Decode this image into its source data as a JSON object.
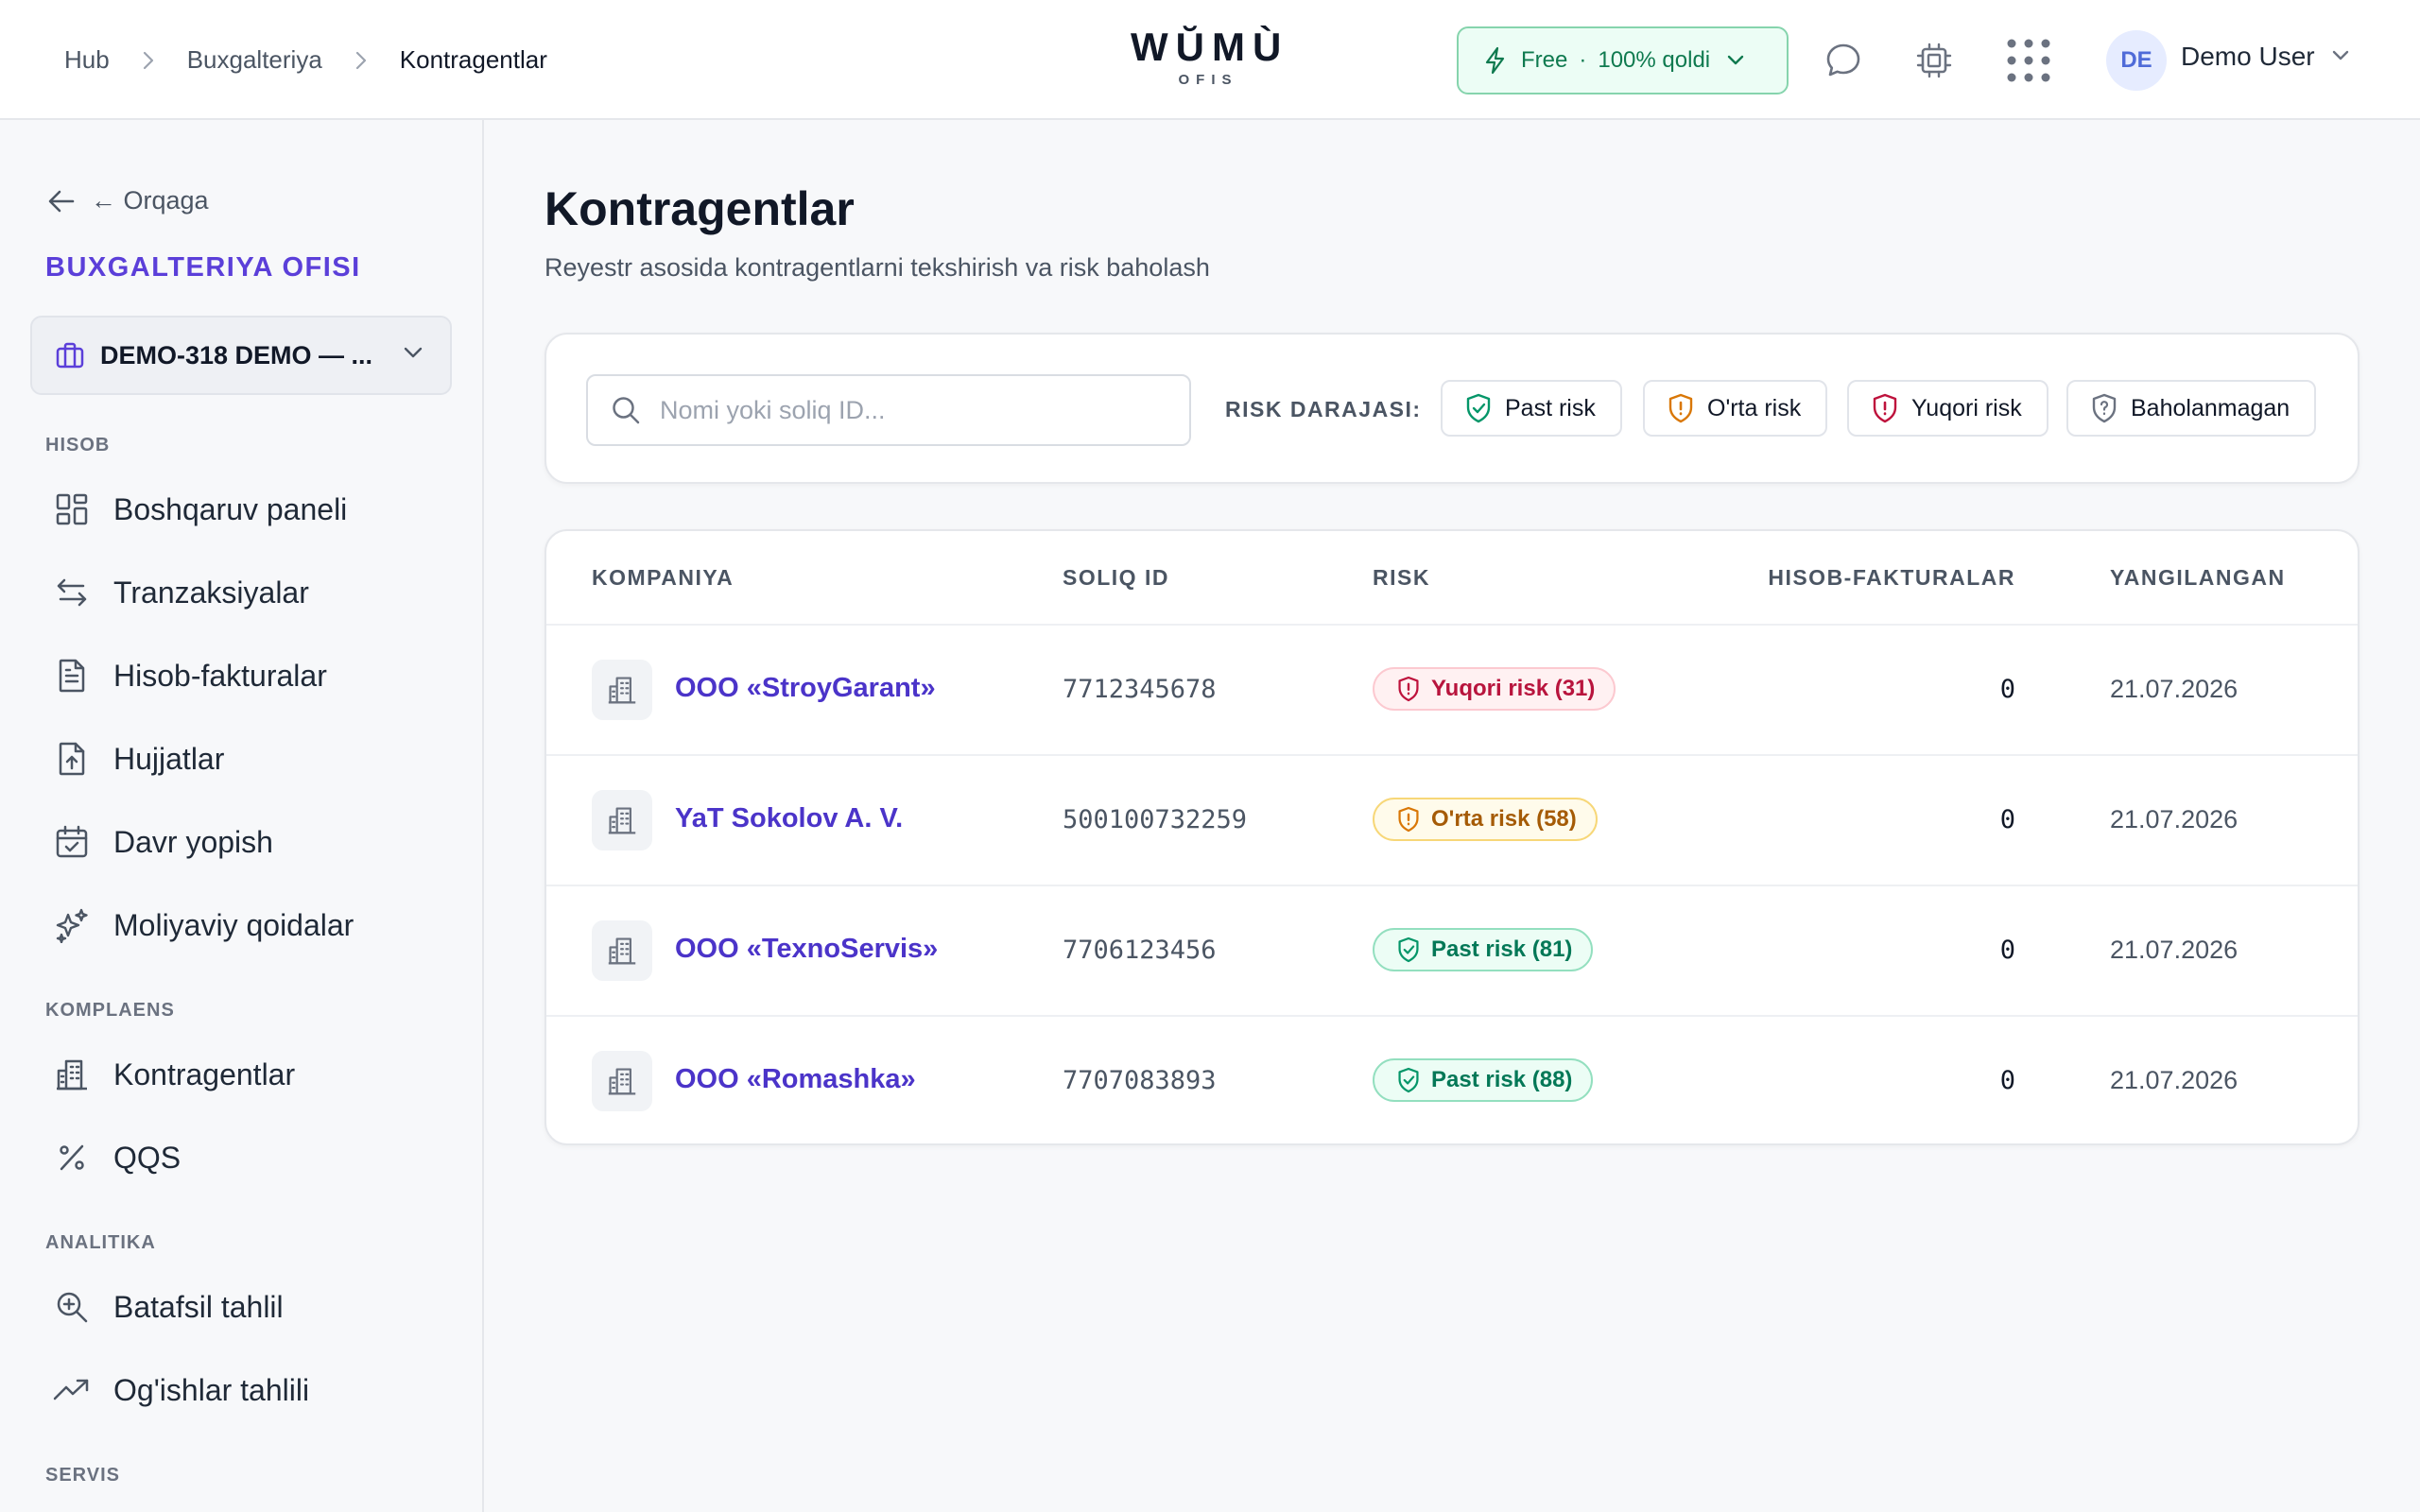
{
  "header": {
    "breadcrumb": [
      "Hub",
      "Buxgalteriya",
      "Kontragentlar"
    ],
    "logo": {
      "word": "WŬMÙ",
      "sub": "OFIS"
    },
    "plan": {
      "name": "Free",
      "remaining": "100% qoldi"
    },
    "user": {
      "initials": "DE",
      "name": "Demo User"
    }
  },
  "sidebar": {
    "back_label": "← Orqaga",
    "office_title": "BUXGALTERIYA OFISI",
    "org_select": "DEMO-318 DEMO — ...",
    "sections": [
      {
        "label": "HISOB",
        "items": [
          "Boshqaruv paneli",
          "Tranzaksiyalar",
          "Hisob-fakturalar",
          "Hujjatlar",
          "Davr yopish",
          "Moliyaviy qoidalar"
        ]
      },
      {
        "label": "KOMPLAENS",
        "items": [
          "Kontragentlar",
          "QQS"
        ]
      },
      {
        "label": "ANALITIKA",
        "items": [
          "Batafsil tahlil",
          "Og'ishlar tahlili"
        ]
      },
      {
        "label": "SERVIS",
        "items": []
      }
    ]
  },
  "main": {
    "title": "Kontragentlar",
    "subtitle": "Reyestr asosida kontragentlarni tekshirish va risk baholash",
    "search_placeholder": "Nomi yoki soliq ID...",
    "risk_filter_label": "RISK DARAJASI:",
    "risk_filters": [
      "Past risk",
      "O'rta risk",
      "Yuqori risk",
      "Baholanmagan"
    ],
    "table": {
      "headers": [
        "KOMPANIYA",
        "SOLIQ ID",
        "RISK",
        "HISOB-FAKTURALAR",
        "YANGILANGAN"
      ],
      "rows": [
        {
          "company": "ООО «StroyGarant»",
          "tax_id": "7712345678",
          "risk": "Yuqori risk (31)",
          "invoices": "0",
          "updated": "21.07.2026"
        },
        {
          "company": "YaT Sokolov A. V.",
          "tax_id": "500100732259",
          "risk": "O'rta risk (58)",
          "invoices": "0",
          "updated": "21.07.2026"
        },
        {
          "company": "ООО «TexnoServis»",
          "tax_id": "7706123456",
          "risk": "Past risk (81)",
          "invoices": "0",
          "updated": "21.07.2026"
        },
        {
          "company": "ООО «Romashka»",
          "tax_id": "7707083893",
          "risk": "Past risk (88)",
          "invoices": "0",
          "updated": "21.07.2026"
        }
      ]
    }
  },
  "colors": {
    "accent": "#5b3fd9",
    "link": "#4b34c9",
    "high_risk": "#b8143d",
    "mid_risk": "#a55b06",
    "low_risk": "#047857"
  }
}
